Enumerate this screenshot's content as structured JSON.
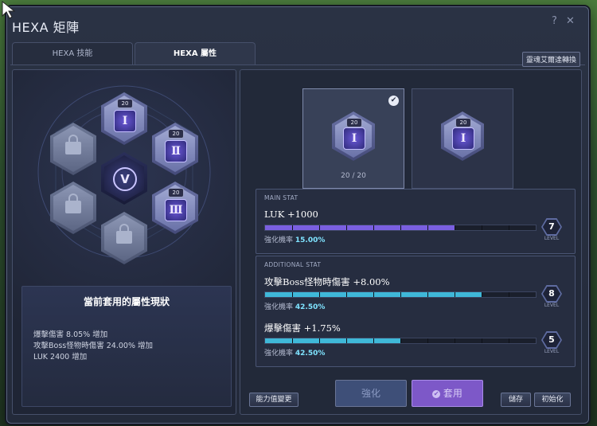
{
  "window": {
    "title": "HEXA 矩陣",
    "help": "?",
    "close": "✕"
  },
  "tabs": [
    {
      "label": "HEXA 技能",
      "active": false
    },
    {
      "label": "HEXA 屬性",
      "active": true
    }
  ],
  "soul_button": "靈魂艾爾達轉換",
  "left": {
    "nodes": [
      {
        "badge": "20",
        "symbol": "Ⅰ",
        "state": "active",
        "selected": true
      },
      {
        "badge": "20",
        "symbol": "Ⅱ",
        "state": "active"
      },
      {
        "badge": "20",
        "symbol": "Ⅲ",
        "state": "active"
      }
    ],
    "core_symbol": "V",
    "status": {
      "title": "當前套用的屬性現狀",
      "lines": [
        "爆擊傷害 8.05% 增加",
        "攻擊Boss怪物時傷害 24.00% 增加",
        "LUK 2400 增加"
      ]
    }
  },
  "cards": [
    {
      "badge": "20",
      "symbol": "Ⅰ",
      "count": "20 / 20",
      "selected": true
    },
    {
      "badge": "20",
      "symbol": "Ⅰ"
    }
  ],
  "main_stat": {
    "label": "MAIN STAT",
    "text": "LUK +1000",
    "chance_label": "強化機率",
    "chance_value": "15.00%",
    "level": "7",
    "level_label": "LEVEL",
    "progress": 0.7
  },
  "additional_stat": {
    "label": "ADDITIONAL STAT",
    "rows": [
      {
        "text": "攻擊Boss怪物時傷害 +8.00%",
        "chance_label": "強化機率",
        "chance_value": "42.50%",
        "level": "8",
        "level_label": "LEVEL",
        "progress": 0.8
      },
      {
        "text": "爆擊傷害 +1.75%",
        "chance_label": "強化機率",
        "chance_value": "42.50%",
        "level": "5",
        "level_label": "LEVEL",
        "progress": 0.5
      }
    ]
  },
  "buttons": {
    "change": "能力值變更",
    "enhance": "強化",
    "apply": "套用",
    "save": "儲存",
    "reset": "初始化"
  },
  "colors": {
    "main_bar": "#7a5fe0",
    "add_bar": "#3fb8d8",
    "apply_button": "#7d58c8",
    "enhance_button": "#3e4f78"
  }
}
